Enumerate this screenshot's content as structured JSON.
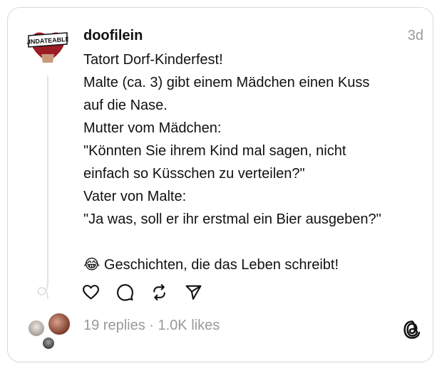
{
  "post": {
    "username": "doofilein",
    "time": "3d",
    "avatar_badge": "UNDATEABLE",
    "lines": [
      "Tatort Dorf-Kinderfest!",
      "Malte (ca. 3) gibt einem Mädchen einen Kuss",
      "auf die Nase.",
      "Mutter vom Mädchen:",
      "\"Könnten Sie ihrem Kind mal sagen, nicht",
      "einfach so Küsschen zu verteilen?\"",
      "Vater von Malte:",
      "\"Ja was, soll er ihr erstmal ein Bier ausgeben?\"",
      "",
      "😂 Geschichten, die das Leben schreibt!"
    ],
    "stats": "19 replies · 1.0K likes"
  },
  "actions": [
    {
      "name": "like-button",
      "icon": "heart-icon"
    },
    {
      "name": "reply-button",
      "icon": "comment-icon"
    },
    {
      "name": "repost-button",
      "icon": "repost-icon"
    },
    {
      "name": "share-button",
      "icon": "send-icon"
    }
  ],
  "colors": {
    "text": "#111111",
    "muted": "#999999",
    "border": "#d9d9d9",
    "avatar_badge": "#9b1c24"
  }
}
